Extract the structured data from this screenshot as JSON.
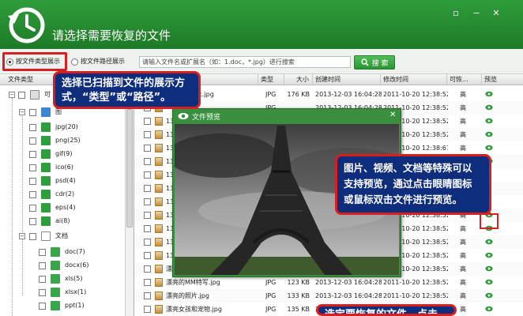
{
  "window": {
    "title": "请选择需要恢复的文件",
    "min_glyph": "▫",
    "minimize_glyph": "−",
    "close_glyph": "✕"
  },
  "toolbar": {
    "radio_by_type": "按文件类型展示",
    "radio_by_path": "按文件路径展示",
    "search_placeholder": "请输入文件名或扩展名（如：1.doc，*.jpg）进行搜索",
    "search_button": "搜 索"
  },
  "tree": {
    "header": "文件类型",
    "root_label": "可",
    "image_group_label": "图",
    "items": [
      {
        "label": "jpg(20)",
        "color": "#2f9e3c"
      },
      {
        "label": "png(25)",
        "color": "#2f9e3c"
      },
      {
        "label": "gif(9)",
        "color": "#2f9e3c"
      },
      {
        "label": "ico(6)",
        "color": "#2f9e3c"
      },
      {
        "label": "psd(4)",
        "color": "#2f9e3c"
      },
      {
        "label": "cdr(2)",
        "color": "#2f9e3c"
      },
      {
        "label": "eps(4)",
        "color": "#2f9e3c"
      },
      {
        "label": "ai(8)",
        "color": "#2f9e3c"
      }
    ],
    "doc_group_label": "文档",
    "doc_items": [
      {
        "label": "doc(7)"
      },
      {
        "label": "docx(6)"
      },
      {
        "label": "xls(5)"
      },
      {
        "label": "xlsx(1)"
      },
      {
        "label": "ppt(1)"
      }
    ]
  },
  "table": {
    "columns": [
      "类型",
      "大小",
      "创建时间",
      "修改时间",
      "可恢...",
      "预览"
    ],
    "rows": [
      {
        "name": "czqsqsn0zc.jpg",
        "type": "JPG",
        "size": "176 KB",
        "created": "2013-12-03 16:04:28",
        "modified": "2011-10-20 12:38:52",
        "recover": "高"
      },
      {
        "name": "",
        "type": "JPG",
        "size": "",
        "created": "2013-12-03 16:04:28",
        "modified": "2011-10-20 12:38:52",
        "recover": "高"
      },
      {
        "name": "13",
        "type": "",
        "size": "",
        "created": "",
        "modified": "2011-10-20 12:38:52",
        "recover": "高"
      },
      {
        "name": "13",
        "type": "",
        "size": "",
        "created": "",
        "modified": "2011-10-20 12:38:52",
        "recover": "高"
      },
      {
        "name": "13",
        "type": "",
        "size": "",
        "created": "",
        "modified": "2011-10-20 12:38:67",
        "recover": "高"
      },
      {
        "name": "13",
        "type": "",
        "size": "",
        "created": "",
        "modified": "2011-10-20 12:38:52",
        "recover": "高"
      },
      {
        "name": "13",
        "type": "",
        "size": "",
        "created": "",
        "modified": "",
        "recover": ""
      },
      {
        "name": "13",
        "type": "",
        "size": "",
        "created": "",
        "modified": "",
        "recover": ""
      },
      {
        "name": "13",
        "type": "",
        "size": "",
        "created": "",
        "modified": "",
        "recover": ""
      },
      {
        "name": "13",
        "type": "",
        "size": "",
        "created": "",
        "modified": "2011-10-20 12:38:52",
        "recover": "高"
      },
      {
        "name": "13",
        "type": "",
        "size": "",
        "created": "",
        "modified": "2011-10-20 12:38:52",
        "recover": "高"
      },
      {
        "name": "13",
        "type": "",
        "size": "",
        "created": "",
        "modified": "2011-10-20 12:38:52",
        "recover": "高"
      },
      {
        "name": "13",
        "type": "",
        "size": "",
        "created": "",
        "modified": "2011-10-20 12:38:52",
        "recover": "高"
      },
      {
        "name": "漂",
        "type": "",
        "size": "",
        "created": "",
        "modified": "2011-10-20 12:38:52",
        "recover": "高"
      },
      {
        "name": "漂亮的MM特写.jpg",
        "type": "JPG",
        "size": "123 KB",
        "created": "2013-12-03 16:04:28",
        "modified": "2011-10-20 12:38:52",
        "recover": "高"
      },
      {
        "name": "漂亮的照片.jpg",
        "type": "JPG",
        "size": "133 KB",
        "created": "2013-12-03 16:04:28",
        "modified": "2011-10-20 12:38:52",
        "recover": "高"
      },
      {
        "name": "漂亮女孩和宠物.jpg",
        "type": "JPG",
        "size": "135 KB",
        "created": "2013-12-03 16:04:28",
        "modified": "2011-10-20 12:38:52",
        "recover": "高"
      },
      {
        "name": "",
        "type": "",
        "size": "",
        "created": "",
        "modified": "",
        "recover": ""
      }
    ]
  },
  "preview": {
    "title": "文件预览",
    "close_glyph": "✕"
  },
  "callouts": {
    "c1_line1": "选择已扫描到文件的展示方",
    "c1_line2": "式，“类型”或“路径”。",
    "c2_line1": "图片、视频、文档等特殊可以",
    "c2_line2": "支持预览，通过点击眼睛图标",
    "c2_line3": "或鼠标双击文件进行预览。",
    "c3_line1": "选定要恢复的文件，点击"
  },
  "colors": {
    "brand_green": "#2a8f34",
    "callout_bg": "#0e2e7d",
    "highlight_red": "#d92020"
  }
}
